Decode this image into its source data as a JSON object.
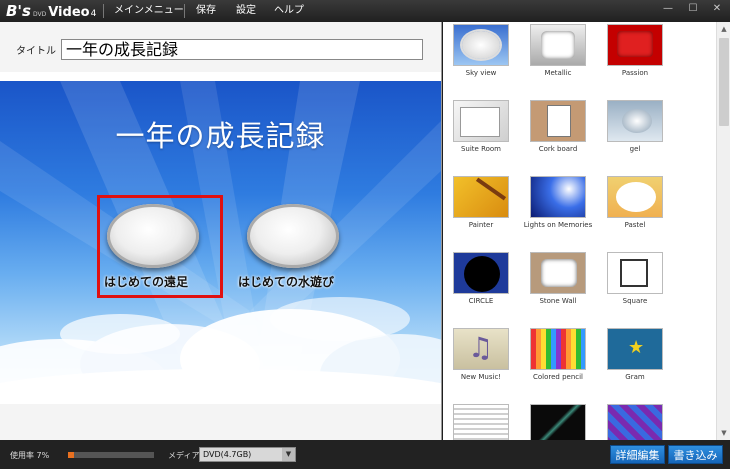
{
  "app": {
    "logo": {
      "b": "B's",
      "dvd": "DVD",
      "video": "Video",
      "version": "4"
    },
    "menu": [
      "メインメニュー",
      "保存",
      "設定",
      "ヘルプ"
    ],
    "window_controls": {
      "minimize": "—",
      "maximize": "☐",
      "close": "✕"
    }
  },
  "editor": {
    "title_label": "タイトル",
    "title_value": "一年の成長記録",
    "preview": {
      "heading": "一年の成長記録",
      "chapters": [
        {
          "label": "はじめての遠足",
          "selected": true
        },
        {
          "label": "はじめての水遊び",
          "selected": false
        }
      ]
    }
  },
  "templates": [
    {
      "name": "Sky view",
      "icon": "sky-view-thumb"
    },
    {
      "name": "Metallic",
      "icon": "metallic-thumb"
    },
    {
      "name": "Passion",
      "icon": "passion-thumb"
    },
    {
      "name": "Suite Room",
      "icon": "suite-room-thumb"
    },
    {
      "name": "Cork board",
      "icon": "cork-board-thumb"
    },
    {
      "name": "gel",
      "icon": "gel-thumb"
    },
    {
      "name": "Painter",
      "icon": "painter-thumb"
    },
    {
      "name": "Lights on Memories",
      "icon": "lights-thumb"
    },
    {
      "name": "Pastel",
      "icon": "pastel-thumb"
    },
    {
      "name": "CIRCLE",
      "icon": "circle-thumb"
    },
    {
      "name": "Stone Wall",
      "icon": "stone-wall-thumb"
    },
    {
      "name": "Square",
      "icon": "square-thumb"
    },
    {
      "name": "New Music!",
      "icon": "new-music-thumb"
    },
    {
      "name": "Colored pencil",
      "icon": "colored-pencil-thumb"
    },
    {
      "name": "Gram",
      "icon": "gram-thumb"
    },
    {
      "name": "",
      "icon": "lines-thumb"
    },
    {
      "name": "",
      "icon": "diagonal-thumb"
    },
    {
      "name": "",
      "icon": "tiles-thumb"
    }
  ],
  "status": {
    "usage_label": "使用率 7%",
    "usage_percent": 7,
    "media_label": "メディア",
    "media_value": "DVD(4.7GB)",
    "media_arrow": "▼",
    "detail_button": "詳細編集",
    "write_button": "書き込み"
  },
  "colors": {
    "accent": "#1565b8",
    "selection": "#e01010",
    "usage_fill": "#e87020"
  }
}
